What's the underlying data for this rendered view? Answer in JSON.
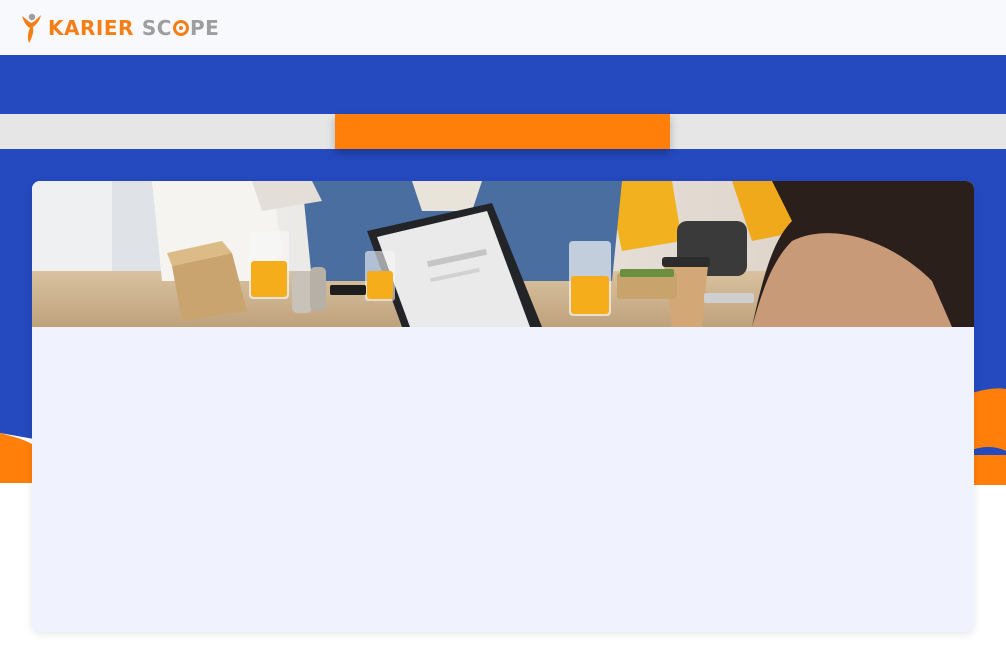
{
  "header": {
    "logo_word1": "KARIER",
    "logo_word2_pre": "SC",
    "logo_word2_post": "PE"
  },
  "tabs": [
    {
      "label": "",
      "active": false
    },
    {
      "label": "",
      "active": true
    },
    {
      "label": "",
      "active": false
    }
  ],
  "colors": {
    "brand_orange": "#ff7f0a",
    "brand_blue": "#2549bf",
    "logo_gray": "#9e9e9e",
    "card_bg": "#f0f3fd"
  },
  "icons": {
    "logo": "person-flame-logo-icon"
  }
}
